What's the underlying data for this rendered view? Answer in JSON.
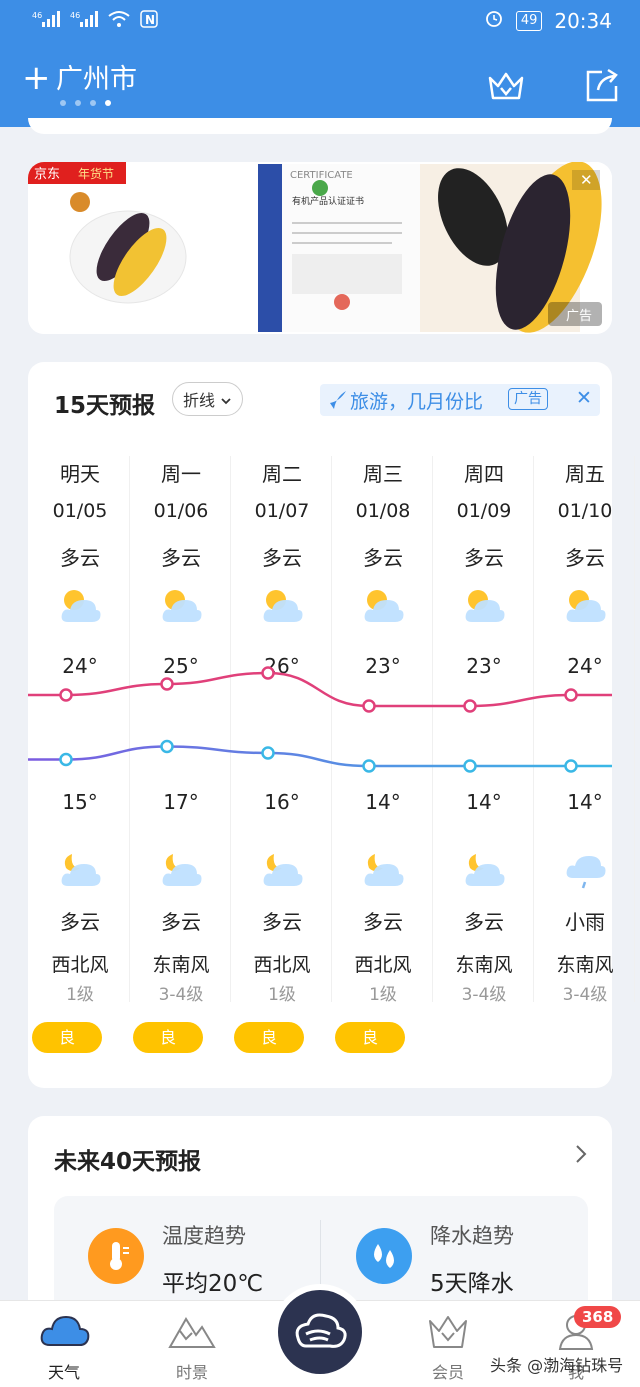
{
  "status_bar": {
    "signal_1": "46",
    "signal_2": "46",
    "battery": "49",
    "time": "20:34"
  },
  "header": {
    "add_symbol": "+",
    "city": "广州市",
    "page_dots": 4,
    "active_dot": 3
  },
  "ad_banner": {
    "brand": "京东",
    "brand_tag": "年货节",
    "cert_title": "CERTIFICATE",
    "cert_subtitle": "有机产品认证证书",
    "ad_label": "广告",
    "close": "✕"
  },
  "forecast": {
    "title": "15天预报",
    "view_mode": "折线",
    "promo_text": "旅游，几月份比",
    "promo_tag": "广告",
    "promo_close": "✕",
    "days": [
      {
        "name": "明天",
        "date": "01/05",
        "day_cond": "多云",
        "high": "24°",
        "high_val": 24,
        "low": "15°",
        "low_val": 15,
        "night_cond": "多云",
        "wind": "西北风",
        "level": "1级",
        "aqi": "良",
        "day_icon": "partly-cloudy-day-icon",
        "night_icon": "partly-cloudy-night-icon"
      },
      {
        "name": "周一",
        "date": "01/06",
        "day_cond": "多云",
        "high": "25°",
        "high_val": 25,
        "low": "17°",
        "low_val": 17,
        "night_cond": "多云",
        "wind": "东南风",
        "level": "3-4级",
        "aqi": "良",
        "day_icon": "partly-cloudy-day-icon",
        "night_icon": "partly-cloudy-night-icon"
      },
      {
        "name": "周二",
        "date": "01/07",
        "day_cond": "多云",
        "high": "26°",
        "high_val": 26,
        "low": "16°",
        "low_val": 16,
        "night_cond": "多云",
        "wind": "西北风",
        "level": "1级",
        "aqi": "良",
        "day_icon": "partly-cloudy-day-icon",
        "night_icon": "partly-cloudy-night-icon"
      },
      {
        "name": "周三",
        "date": "01/08",
        "day_cond": "多云",
        "high": "23°",
        "high_val": 23,
        "low": "14°",
        "low_val": 14,
        "night_cond": "多云",
        "wind": "西北风",
        "level": "1级",
        "aqi": "良",
        "day_icon": "partly-cloudy-day-icon",
        "night_icon": "partly-cloudy-night-icon"
      },
      {
        "name": "周四",
        "date": "01/09",
        "day_cond": "多云",
        "high": "23°",
        "high_val": 23,
        "low": "14°",
        "low_val": 14,
        "night_cond": "多云",
        "wind": "东南风",
        "level": "3-4级",
        "aqi": "",
        "day_icon": "partly-cloudy-day-icon",
        "night_icon": "partly-cloudy-night-icon"
      },
      {
        "name": "周五",
        "date": "01/10",
        "day_cond": "多云",
        "high": "24°",
        "high_val": 24,
        "low": "14°",
        "low_val": 14,
        "night_cond": "小雨",
        "wind": "东南风",
        "level": "3-4级",
        "aqi": "",
        "day_icon": "partly-cloudy-day-icon",
        "night_icon": "light-rain-icon"
      }
    ],
    "colors": {
      "high_line": "#e0407a",
      "low_line_start": "#7b5be0",
      "low_line_end": "#3ab8e6",
      "aqi_good": "#ffc300"
    }
  },
  "forecast40": {
    "title": "未来40天预报",
    "temp_label": "温度趋势",
    "temp_value": "平均20℃",
    "rain_label": "降水趋势",
    "rain_value": "5天降水"
  },
  "bottom_nav": {
    "items": [
      {
        "label": "天气",
        "icon": "cloud-icon",
        "active": true
      },
      {
        "label": "时景",
        "icon": "mountain-icon",
        "active": false
      },
      {
        "label": "会员",
        "icon": "crown-icon",
        "active": false
      },
      {
        "label": "我",
        "icon": "user-icon",
        "active": false
      }
    ],
    "badge": "368"
  },
  "watermark": "头条 @渤海钻珠号",
  "accent_color": "#3d8ee6"
}
